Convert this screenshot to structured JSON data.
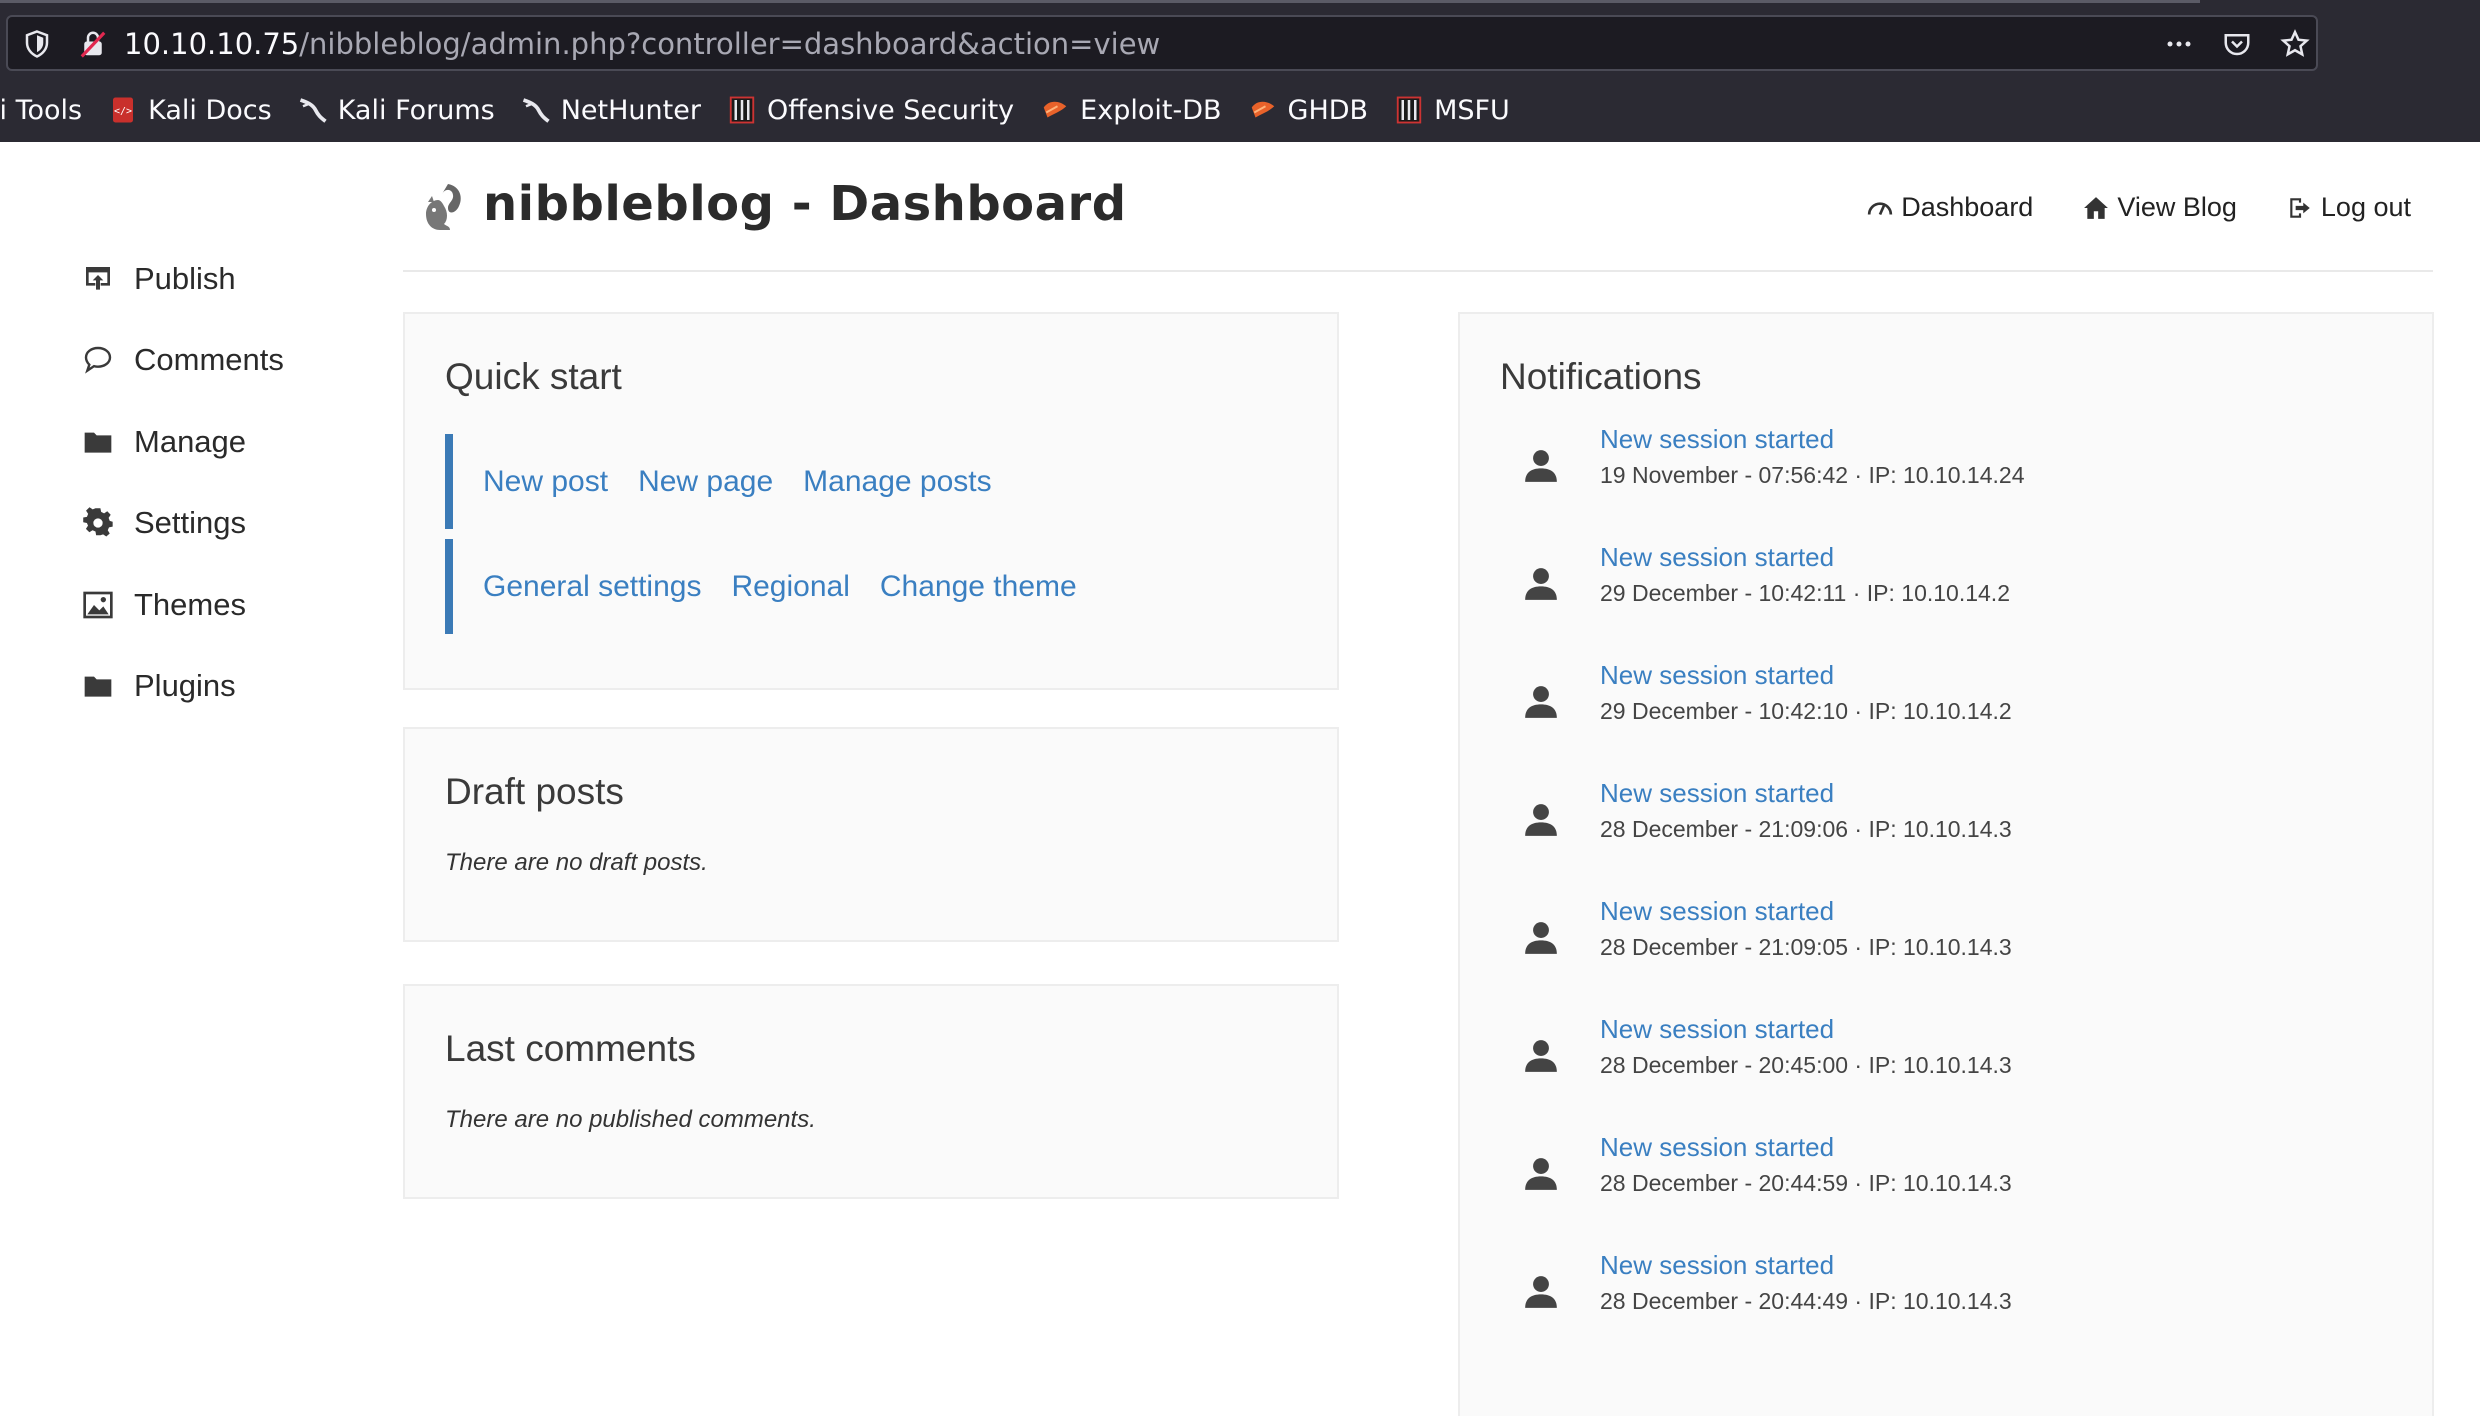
{
  "browser": {
    "url_host": "10.10.10.75",
    "url_path": "/nibbleblog/admin.php?controller=dashboard&action=view",
    "bookmarks": [
      {
        "label": "li Tools",
        "icon": "kali-tools-icon"
      },
      {
        "label": "Kali Docs",
        "icon": "kali-docs-icon"
      },
      {
        "label": "Kali Forums",
        "icon": "kali-forums-icon"
      },
      {
        "label": "NetHunter",
        "icon": "nethunter-icon"
      },
      {
        "label": "Offensive Security",
        "icon": "offsec-icon"
      },
      {
        "label": "Exploit-DB",
        "icon": "exploit-db-icon"
      },
      {
        "label": "GHDB",
        "icon": "ghdb-icon"
      },
      {
        "label": "MSFU",
        "icon": "msfu-icon"
      }
    ]
  },
  "header": {
    "title": "nibbleblog - Dashboard",
    "nav": [
      {
        "label": "Dashboard",
        "icon": "dashboard-gauge-icon"
      },
      {
        "label": "View Blog",
        "icon": "home-icon"
      },
      {
        "label": "Log out",
        "icon": "logout-icon"
      }
    ]
  },
  "sidebar": {
    "items": [
      {
        "label": "Publish",
        "icon": "publish-icon"
      },
      {
        "label": "Comments",
        "icon": "comment-icon"
      },
      {
        "label": "Manage",
        "icon": "folder-icon"
      },
      {
        "label": "Settings",
        "icon": "gear-icon"
      },
      {
        "label": "Themes",
        "icon": "picture-icon"
      },
      {
        "label": "Plugins",
        "icon": "folder-icon"
      }
    ]
  },
  "quick_start": {
    "title": "Quick start",
    "row1": [
      "New post",
      "New page",
      "Manage posts"
    ],
    "row2": [
      "General settings",
      "Regional",
      "Change theme"
    ]
  },
  "draft_posts": {
    "title": "Draft posts",
    "empty_text": "There are no draft posts."
  },
  "last_comments": {
    "title": "Last comments",
    "empty_text": "There are no published comments."
  },
  "notifications": {
    "title": "Notifications",
    "items": [
      {
        "title": "New session started",
        "meta": "19 November - 07:56:42 · IP: 10.10.14.24"
      },
      {
        "title": "New session started",
        "meta": "29 December - 10:42:11 · IP: 10.10.14.2"
      },
      {
        "title": "New session started",
        "meta": "29 December - 10:42:10 · IP: 10.10.14.2"
      },
      {
        "title": "New session started",
        "meta": "28 December - 21:09:06 · IP: 10.10.14.3"
      },
      {
        "title": "New session started",
        "meta": "28 December - 21:09:05 · IP: 10.10.14.3"
      },
      {
        "title": "New session started",
        "meta": "28 December - 20:45:00 · IP: 10.10.14.3"
      },
      {
        "title": "New session started",
        "meta": "28 December - 20:44:59 · IP: 10.10.14.3"
      },
      {
        "title": "New session started",
        "meta": "28 December - 20:44:49 · IP: 10.10.14.3"
      }
    ]
  },
  "colors": {
    "link": "#3a7fc1",
    "accent_bar": "#3b7ab6",
    "chrome_bg": "#2b2a33"
  }
}
